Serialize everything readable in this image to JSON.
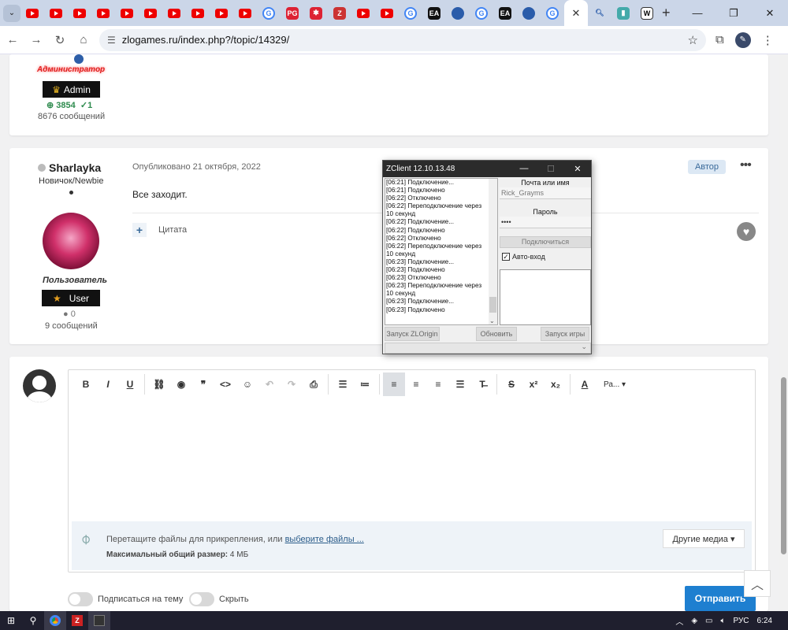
{
  "browser": {
    "url": "zlogames.ru/index.php?/topic/14329/",
    "new_tab_label": "+"
  },
  "post_admin": {
    "role": "Администратор",
    "badge": "Admin",
    "rep_plus": "3854",
    "rep_check": "1",
    "posts": "8676 сообщений"
  },
  "post_user": {
    "author": "Sharlayka",
    "rank": "Новичок/Newbie",
    "role": "Пользователь",
    "badge": "User",
    "rep": "0",
    "posts": "9 сообщений",
    "published": "Опубликовано 21 октября, 2022",
    "author_tag": "Автор",
    "text": "Все заходит.",
    "quote_label": "Цитата"
  },
  "editor": {
    "font_label": "Ра...",
    "attach_text": "Перетащите файлы для прикрепления, или ",
    "attach_link": "выберите файлы ...",
    "max_label": "Максимальный общий размер:",
    "max_value": "4 МБ",
    "media_button": "Другие медиа ▾",
    "subscribe_label": "Подписаться на тему",
    "hide_label": "Скрыть",
    "submit": "Отправить"
  },
  "zclient": {
    "title": "ZClient 12.10.13.48",
    "log": [
      "[06:21] Подключение...",
      "[06:21] Подключено",
      "[06:22] Отключено",
      "[06:22] Переподключение через 10 секунд",
      "[06:22] Подключение...",
      "[06:22] Подключено",
      "[06:22] Отключено",
      "[06:22] Переподключение через 10 секунд",
      "[06:23] Подключение...",
      "[06:23] Подключено",
      "[06:23] Отключено",
      "[06:23] Переподключение через 10 секунд",
      "[06:23] Подключение...",
      "[06:23] Подключено"
    ],
    "email_label": "Почта или имя",
    "email_value": "Rick_Grayms",
    "password_label": "Пароль",
    "password_value": "••••",
    "connect_button": "Подключиться",
    "auto_login": "Авто-вход",
    "btn_zlorigin": "Запуск ZLOrigin",
    "btn_refresh": "Обновить",
    "btn_launch": "Запуск игры"
  },
  "taskbar": {
    "lang": "РУС",
    "time": "6:24"
  },
  "colors": {
    "accent": "#1e7fd0",
    "admin_role": "#e02020",
    "rep_positive": "#2e8b4e"
  }
}
